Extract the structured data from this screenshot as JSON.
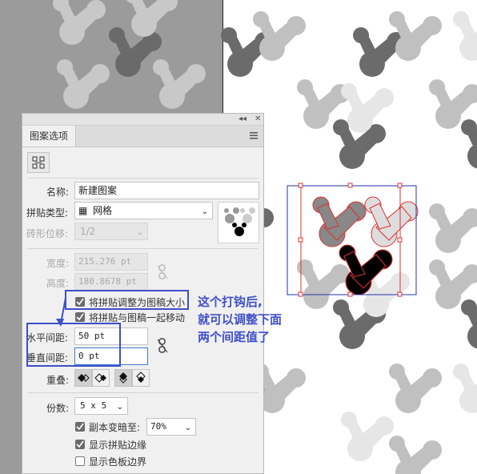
{
  "panel": {
    "title_tab": "图案选项",
    "tile_tool_icon": "tile-tool-icon",
    "name_label": "名称:",
    "name_value": "新建图案",
    "tile_type_label": "拼贴类型:",
    "tile_type_value": "网格",
    "brick_offset_label": "砖形位移:",
    "brick_offset_value": "1/2",
    "width_label": "宽度:",
    "width_value": "215.276 pt",
    "height_label": "高度:",
    "height_value": "180.8678 pt",
    "cb_resize_label": "将拼贴调整为图稿大小",
    "cb_resize_checked": true,
    "cb_move_label": "将拼贴与图稿一起移动",
    "cb_move_checked": true,
    "h_spacing_label": "水平间距:",
    "h_spacing_value": "50 pt",
    "v_spacing_label": "垂直间距:",
    "v_spacing_value": "0 pt",
    "overlap_label": "重叠:",
    "copies_label": "份数:",
    "copies_value": "5 x 5",
    "dim_copies_label": "副本变暗至:",
    "dim_copies_checked": true,
    "dim_copies_value": "70%",
    "show_tile_edge_label": "显示拼贴边缘",
    "show_tile_edge_checked": true,
    "show_swatch_bounds_label": "显示色板边界",
    "show_swatch_bounds_checked": false
  },
  "annotation": {
    "line1": "这个打钩后,",
    "line2": "就可以调整下面",
    "line3": "两个间距值了",
    "color": "#3f4fc7"
  },
  "colors": {
    "dark_gray": "#666666",
    "light_gray": "#c2c2c2",
    "pale_gray": "#e5e5e5",
    "black": "#000000",
    "tile_outline": "#e03030",
    "bbox_outline": "#2233aa"
  }
}
